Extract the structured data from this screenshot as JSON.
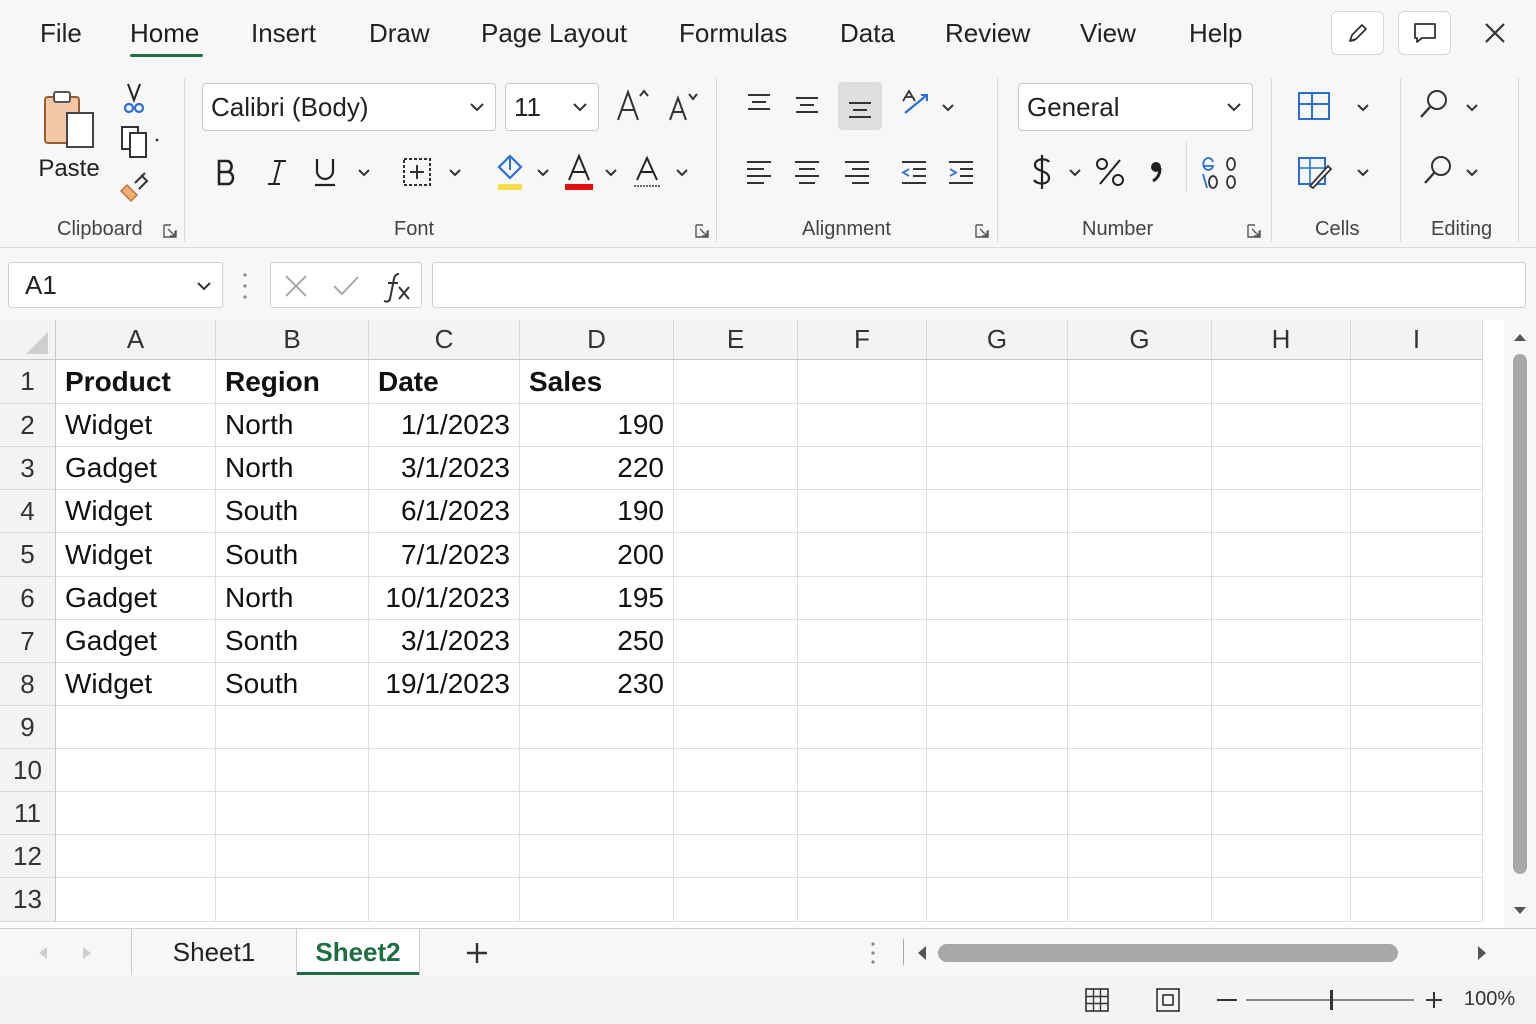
{
  "tabs": [
    "File",
    "Home",
    "Insert",
    "Draw",
    "Page Layout",
    "Formulas",
    "Data",
    "Review",
    "View",
    "Help"
  ],
  "ribbon": {
    "clipboard": {
      "label": "Clipboard",
      "paste_label": "Paste"
    },
    "font": {
      "label": "Font",
      "family": "Calibri (Body)",
      "size": "11"
    },
    "alignment": {
      "label": "Alignment"
    },
    "number": {
      "label": "Number",
      "format": "General"
    },
    "cells": {
      "label": "Cells"
    },
    "editing": {
      "label": "Editing"
    }
  },
  "formula_bar": {
    "name_box": "A1",
    "formula": ""
  },
  "columns": [
    "A",
    "B",
    "C",
    "D",
    "E",
    "F",
    "G",
    "G",
    "H",
    "I"
  ],
  "rows": [
    "1",
    "2",
    "3",
    "4",
    "5",
    "6",
    "7",
    "8",
    "9",
    "10",
    "11",
    "12",
    "13"
  ],
  "table": {
    "headers": [
      "Product",
      "Region",
      "Date",
      "Sales"
    ],
    "rows": [
      [
        "Widget",
        "North",
        "1/1/2023",
        "190"
      ],
      [
        "Gadget",
        "North",
        "3/1/2023",
        "220"
      ],
      [
        "Widget",
        "South",
        "6/1/2023",
        "190"
      ],
      [
        "Widget",
        "South",
        "7/1/2023",
        "200"
      ],
      [
        "Gadget",
        "North",
        "10/1/2023",
        "195"
      ],
      [
        "Gadget",
        "Sonth",
        "3/1/2023",
        "250"
      ],
      [
        "Widget",
        "South",
        "19/1/2023",
        "230"
      ]
    ]
  },
  "sheets": {
    "items": [
      "Sheet1",
      "Sheet2"
    ],
    "active": "Sheet2"
  },
  "status": {
    "zoom": "100%"
  },
  "colors": {
    "accent": "#1e6e42",
    "highlight": "#f5e04c",
    "font_red": "#e01010"
  }
}
